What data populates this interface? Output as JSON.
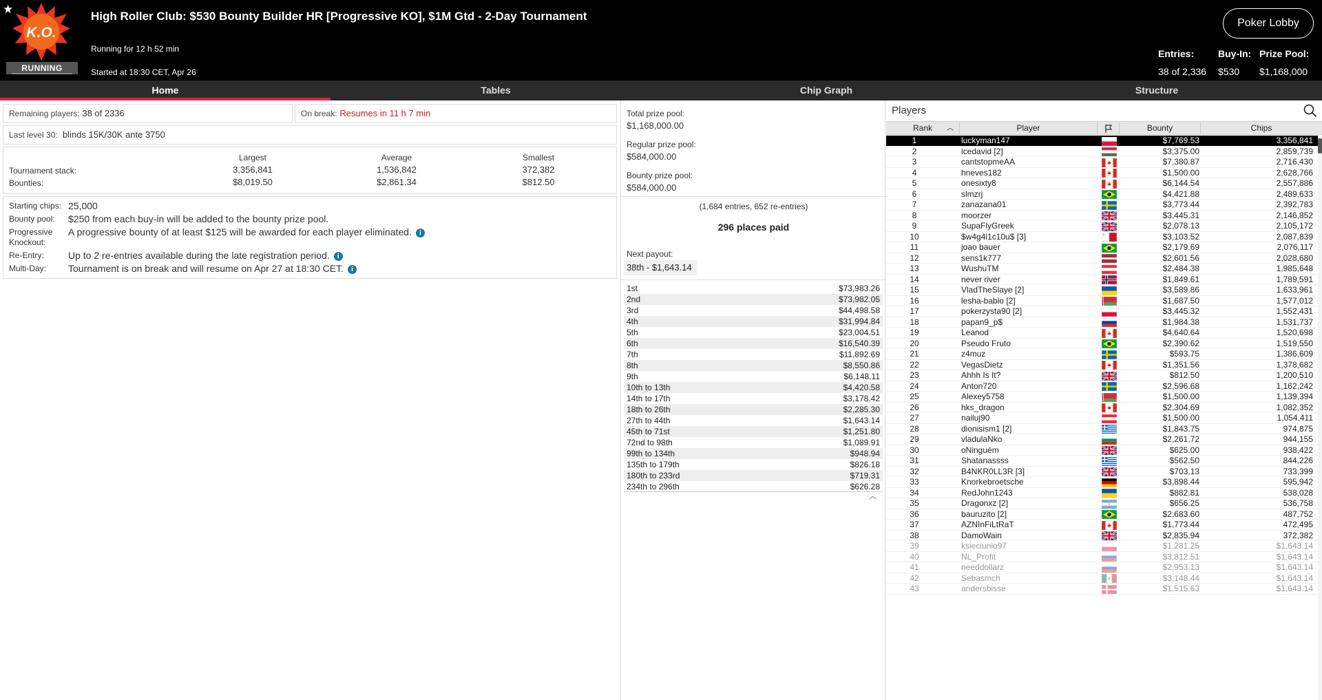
{
  "header": {
    "title": "High Roller Club: $530 Bounty Builder HR [Progressive KO], $1M Gtd - 2-Day Tournament",
    "logo_text": "K.O.",
    "status_badge": "RUNNING",
    "running_for": "Running for 12 h 52 min",
    "started_at": "Started at 18:30 CET, Apr 26",
    "poker_lobby_label": "Poker Lobby",
    "entries_label": "Entries:",
    "entries_value": "38 of 2,336",
    "buyin_label": "Buy-In:",
    "buyin_value": "$530",
    "prizepool_label": "Prize Pool:",
    "prizepool_value": "$1,168,000"
  },
  "tabs": [
    {
      "label": "Home",
      "active": true
    },
    {
      "label": "Tables",
      "active": false
    },
    {
      "label": "Chip Graph",
      "active": false
    },
    {
      "label": "Structure",
      "active": false
    }
  ],
  "home": {
    "remaining_label": "Remaining players:",
    "remaining_value": "38 of 2336",
    "break_label": "On break:",
    "break_value": "Resumes in 11 h 7 min",
    "last_level_label": "Last level 30:",
    "last_level_value": "blinds 15K/30K ante 3750",
    "stacks": {
      "largest_label": "Largest",
      "average_label": "Average",
      "smallest_label": "Smallest",
      "tournament_stack_label": "Tournament stack:",
      "bounties_label": "Bounties:",
      "largest_stack": "3,356,841",
      "average_stack": "1,536,842",
      "smallest_stack": "372,382",
      "largest_bounty": "$8,019.50",
      "average_bounty": "$2,861.34",
      "smallest_bounty": "$812.50"
    },
    "info": {
      "starting_chips_label": "Starting chips:",
      "starting_chips_value": "25,000",
      "bounty_pool_label": "Bounty pool:",
      "bounty_pool_value": "$250 from each buy-in will be added to the bounty prize pool.",
      "pko_label": "Progressive Knockout:",
      "pko_value": "A progressive bounty of at least $125 will be awarded for each player eliminated.",
      "reentry_label": "Re-Entry:",
      "reentry_value": "Up to 2 re-entries available during the late registration period.",
      "multiday_label": "Multi-Day:",
      "multiday_value": "Tournament is on break and will resume on Apr 27 at 18:30 CET."
    }
  },
  "prizes": {
    "total_label": "Total prize pool:",
    "total_value": "$1,168,000.00",
    "regular_label": "Regular prize pool:",
    "regular_value": "$584,000.00",
    "bounty_label": "Bounty prize pool:",
    "bounty_value": "$584,000.00",
    "entries_note": "(1,684 entries, 652 re-entries)",
    "places_paid": "296 places paid",
    "next_payout_label": "Next payout:",
    "next_payout_value": "38th - $1,643.14",
    "payouts": [
      {
        "place": "1st",
        "amount": "$73,983.26"
      },
      {
        "place": "2nd",
        "amount": "$73,982.05"
      },
      {
        "place": "3rd",
        "amount": "$44,498.58"
      },
      {
        "place": "4th",
        "amount": "$31,994.84"
      },
      {
        "place": "5th",
        "amount": "$23,004.51"
      },
      {
        "place": "6th",
        "amount": "$16,540.39"
      },
      {
        "place": "7th",
        "amount": "$11,892.69"
      },
      {
        "place": "8th",
        "amount": "$8,550.86"
      },
      {
        "place": "9th",
        "amount": "$6,148.11"
      },
      {
        "place": "10th to 13th",
        "amount": "$4,420.58"
      },
      {
        "place": "14th to 17th",
        "amount": "$3,178.42"
      },
      {
        "place": "18th to 26th",
        "amount": "$2,285.30"
      },
      {
        "place": "27th to 44th",
        "amount": "$1,643.14"
      },
      {
        "place": "45th to 71st",
        "amount": "$1,251.80"
      },
      {
        "place": "72nd to 98th",
        "amount": "$1,089.91"
      },
      {
        "place": "99th to 134th",
        "amount": "$948.94"
      },
      {
        "place": "135th to 179th",
        "amount": "$826.18"
      },
      {
        "place": "180th to 233rd",
        "amount": "$719.31"
      },
      {
        "place": "234th to 296th",
        "amount": "$626.28"
      }
    ]
  },
  "players": {
    "title": "Players",
    "columns": {
      "rank": "Rank",
      "player": "Player",
      "bounty": "Bounty",
      "chips": "Chips"
    },
    "rows": [
      {
        "rank": "1",
        "name": "luckyman147",
        "flag": "pl",
        "bounty": "$7,769.53",
        "chips": "3,356,841"
      },
      {
        "rank": "2",
        "name": "icedavid [2]",
        "flag": "hu",
        "bounty": "$3,375.00",
        "chips": "2,859,739"
      },
      {
        "rank": "3",
        "name": "cantstopmeAA",
        "flag": "ca",
        "bounty": "$7,380.87",
        "chips": "2,716,430"
      },
      {
        "rank": "4",
        "name": "hneves182",
        "flag": "ca",
        "bounty": "$1,500.00",
        "chips": "2,628,766"
      },
      {
        "rank": "5",
        "name": "onesixty8",
        "flag": "ca",
        "bounty": "$6,144.54",
        "chips": "2,557,886"
      },
      {
        "rank": "6",
        "name": "slmzrj",
        "flag": "br",
        "bounty": "$4,421.88",
        "chips": "2,489,633"
      },
      {
        "rank": "7",
        "name": "zanazana01",
        "flag": "se",
        "bounty": "$3,773.44",
        "chips": "2,392,783"
      },
      {
        "rank": "8",
        "name": "moorzer",
        "flag": "gb",
        "bounty": "$3,445.31",
        "chips": "2,146,852"
      },
      {
        "rank": "9",
        "name": "SupaFlyGreek",
        "flag": "gb",
        "bounty": "$2,078.13",
        "chips": "2,105,172"
      },
      {
        "rank": "10",
        "name": "$w4g4l1c10u$ [3]",
        "flag": "mt",
        "bounty": "$3,103.52",
        "chips": "2,087,839"
      },
      {
        "rank": "11",
        "name": "joao bauer",
        "flag": "br",
        "bounty": "$2,179.69",
        "chips": "2,076,117"
      },
      {
        "rank": "12",
        "name": "sens1k777",
        "flag": "lv",
        "bounty": "$2,601.56",
        "chips": "2,028,680"
      },
      {
        "rank": "13",
        "name": "WushuTM",
        "flag": "at",
        "bounty": "$2,484.38",
        "chips": "1,985,648"
      },
      {
        "rank": "14",
        "name": "never river",
        "flag": "no",
        "bounty": "$1,849.61",
        "chips": "1,789,591"
      },
      {
        "rank": "15",
        "name": "VladTheSlaye [2]",
        "flag": "ua",
        "bounty": "$3,589.86",
        "chips": "1,633,961"
      },
      {
        "rank": "16",
        "name": "lesha-bablo [2]",
        "flag": "by",
        "bounty": "$1,687.50",
        "chips": "1,577,012"
      },
      {
        "rank": "17",
        "name": "pokerzysta90 [2]",
        "flag": "pl",
        "bounty": "$3,445.32",
        "chips": "1,552,431"
      },
      {
        "rank": "18",
        "name": "papan9_p$",
        "flag": "ru",
        "bounty": "$1,984.38",
        "chips": "1,531,737"
      },
      {
        "rank": "19",
        "name": "Leanod",
        "flag": "ca",
        "bounty": "$4,640.64",
        "chips": "1,520,698"
      },
      {
        "rank": "20",
        "name": "Pseudo Fruto",
        "flag": "br",
        "bounty": "$2,390.62",
        "chips": "1,519,550"
      },
      {
        "rank": "21",
        "name": "z4muz",
        "flag": "se",
        "bounty": "$593.75",
        "chips": "1,386,609"
      },
      {
        "rank": "22",
        "name": "VegasDietz",
        "flag": "ca",
        "bounty": "$1,351.56",
        "chips": "1,378,682"
      },
      {
        "rank": "23",
        "name": "Ahhh Is It?",
        "flag": "gb",
        "bounty": "$812.50",
        "chips": "1,200,510"
      },
      {
        "rank": "24",
        "name": "Anton720",
        "flag": "se",
        "bounty": "$2,596.68",
        "chips": "1,162,242"
      },
      {
        "rank": "25",
        "name": "Alexey5758",
        "flag": "by",
        "bounty": "$1,500.00",
        "chips": "1,139,394"
      },
      {
        "rank": "26",
        "name": "hks_dragon",
        "flag": "ca",
        "bounty": "$2,304.69",
        "chips": "1,082,352"
      },
      {
        "rank": "27",
        "name": "nailuj90",
        "flag": "at",
        "bounty": "$1,500.00",
        "chips": "1,054,411"
      },
      {
        "rank": "28",
        "name": "dionisism1 [2]",
        "flag": "gr",
        "bounty": "$1,843.75",
        "chips": "974,875"
      },
      {
        "rank": "29",
        "name": "vladulaNko",
        "flag": "bg",
        "bounty": "$2,261.72",
        "chips": "944,155"
      },
      {
        "rank": "30",
        "name": "oNinguém",
        "flag": "gb",
        "bounty": "$625.00",
        "chips": "938,422"
      },
      {
        "rank": "31",
        "name": "Shatanassss",
        "flag": "gr",
        "bounty": "$562.50",
        "chips": "844,226"
      },
      {
        "rank": "32",
        "name": "B4NKR0LL3R [3]",
        "flag": "gb",
        "bounty": "$703.13",
        "chips": "733,399"
      },
      {
        "rank": "33",
        "name": "Knorkebroetsche",
        "flag": "de",
        "bounty": "$3,898.44",
        "chips": "595,942"
      },
      {
        "rank": "34",
        "name": "RedJohn1243",
        "flag": "ua",
        "bounty": "$882.81",
        "chips": "538,028"
      },
      {
        "rank": "35",
        "name": "Dragonxz [2]",
        "flag": "ar",
        "bounty": "$656.25",
        "chips": "536,758"
      },
      {
        "rank": "36",
        "name": "bauruzito [2]",
        "flag": "br",
        "bounty": "$2,683.60",
        "chips": "487,752"
      },
      {
        "rank": "37",
        "name": "AZNInFiLtRaT",
        "flag": "ca",
        "bounty": "$1,773.44",
        "chips": "472,495"
      },
      {
        "rank": "38",
        "name": "DamoWain",
        "flag": "gb",
        "bounty": "$2,835.94",
        "chips": "372,382"
      },
      {
        "rank": "39",
        "name": "ksieciunio97",
        "flag": "pl",
        "bounty": "$1,281.25",
        "chips": "$1,643.14"
      },
      {
        "rank": "40",
        "name": "NL_Profit",
        "flag": "ru",
        "bounty": "$3,812.51",
        "chips": "$1,643.14"
      },
      {
        "rank": "41",
        "name": "needdollarz",
        "flag": "ru",
        "bounty": "$2,953.13",
        "chips": "$1,643.14"
      },
      {
        "rank": "42",
        "name": "Sebasmch",
        "flag": "mx",
        "bounty": "$3,148.44",
        "chips": "$1,643.14"
      },
      {
        "rank": "43",
        "name": "andersbisse",
        "flag": "dk",
        "bounty": "$1,515.63",
        "chips": "$1,643.14"
      }
    ]
  },
  "colors": {
    "header_bg": "#000000",
    "tab_bar_bg": "#2b2b2b",
    "tab_active_accent": "#d6263b",
    "break_text": "#c4212e",
    "info_icon": "#1a75a8",
    "selected_row_bg": "#000000"
  },
  "icons": [
    "star-icon",
    "ko-logo",
    "info-icon",
    "search-icon",
    "sort-up-icon",
    "flag-header-icon",
    "collapse-chevron-icon"
  ]
}
